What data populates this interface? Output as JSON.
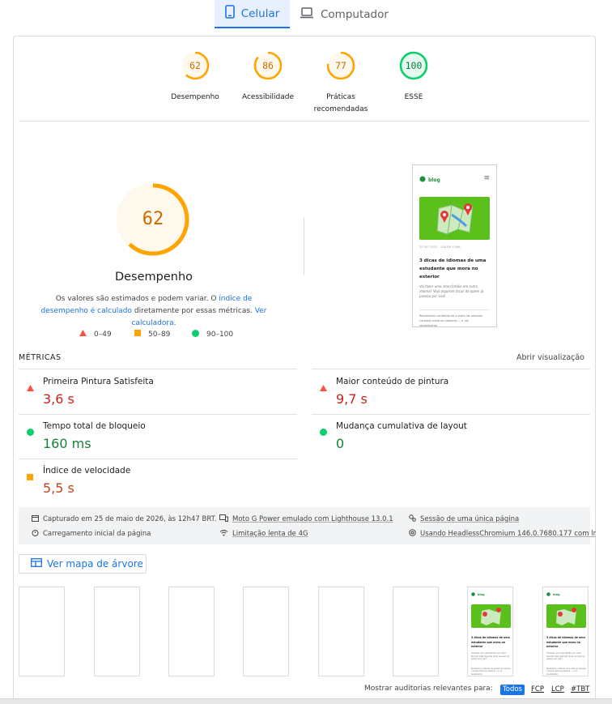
{
  "tabs": [
    {
      "label": "Celular",
      "icon": "mobile-icon",
      "active": true
    },
    {
      "label": "Computador",
      "icon": "laptop-icon",
      "active": false
    }
  ],
  "summary_scores": [
    {
      "score": "62",
      "label": "Desempenho",
      "color": "#ffa400"
    },
    {
      "score": "86",
      "label": "Acessibilidade",
      "color": "#ffa400"
    },
    {
      "score": "77",
      "label_lines": [
        "Práticas",
        "recomendadas"
      ],
      "color": "#ffa400"
    },
    {
      "score": "100",
      "label": "ESSE",
      "color": "#0cce6b"
    }
  ],
  "performance": {
    "score": "62",
    "title": "Desempenho",
    "note_prefix": "Os valores são estimados e podem variar. O ",
    "note_link1": "índice de desempenho é calculado",
    "note_middle": " diretamente por essas métricas. ",
    "note_link2": "Ver calculadora",
    "note_suffix": "."
  },
  "legend": [
    {
      "range": "0–49",
      "icon": "triangle-icon",
      "color": "#ff4e42"
    },
    {
      "range": "50–89",
      "icon": "square-icon",
      "color": "#ffa400"
    },
    {
      "range": "90–100",
      "icon": "circle-icon",
      "color": "#0cce6b"
    }
  ],
  "preview": {
    "logo": "blog",
    "meta": "25 SET 2021 · LEIA EM 4 MIN",
    "title": "3 dicas de idiomas de uma estudante que mora no exterior",
    "excerpt": "Vai fazer uma intercâmbio em outro idioma? Veja algumas dicas de quem já passou por isso!",
    "footer": "Recebemos conteúdo de e-mails de pessoas curiosas sobre as palavras — e um recebimento"
  },
  "metrics": {
    "heading": "MÉTRICAS",
    "expand": "Abrir visualização",
    "items": [
      {
        "label": "Primeira Pintura Satisfeita",
        "value": "3,6 s",
        "rating": "fail"
      },
      {
        "label": "Maior conteúdo de pintura",
        "value": "9,7 s",
        "rating": "fail"
      },
      {
        "label": "Tempo total de bloqueio",
        "value": "160 ms",
        "rating": "pass"
      },
      {
        "label": "Mudança cumulativa de layout",
        "value": "0",
        "rating": "pass"
      },
      {
        "label": "Índice de velocidade",
        "value": "5,5 s",
        "rating": "average"
      }
    ]
  },
  "env": {
    "captured": "Capturado em 25 de maio de 2026, às 12h47 BRT.",
    "device": "Moto G Power emulado com Lighthouse 13.0.1",
    "session": "Sessão de uma única página",
    "load": "Carregamento inicial da página",
    "throttle": "Limitação lenta de 4G",
    "browser": "Usando HeadlessChromium 146.0.7680.177 com lr"
  },
  "treemap_label": "Ver mapa de árvore",
  "filmstrip_frames": 8,
  "filter": {
    "label": "Mostrar auditorias relevantes para:",
    "chips": [
      "Todos",
      "FCP",
      "LCP",
      "#TBT"
    ]
  },
  "colors": {
    "fail": "#c5221f",
    "average": "#ffa400",
    "pass": "#188038",
    "accent": "#1a73e8"
  }
}
